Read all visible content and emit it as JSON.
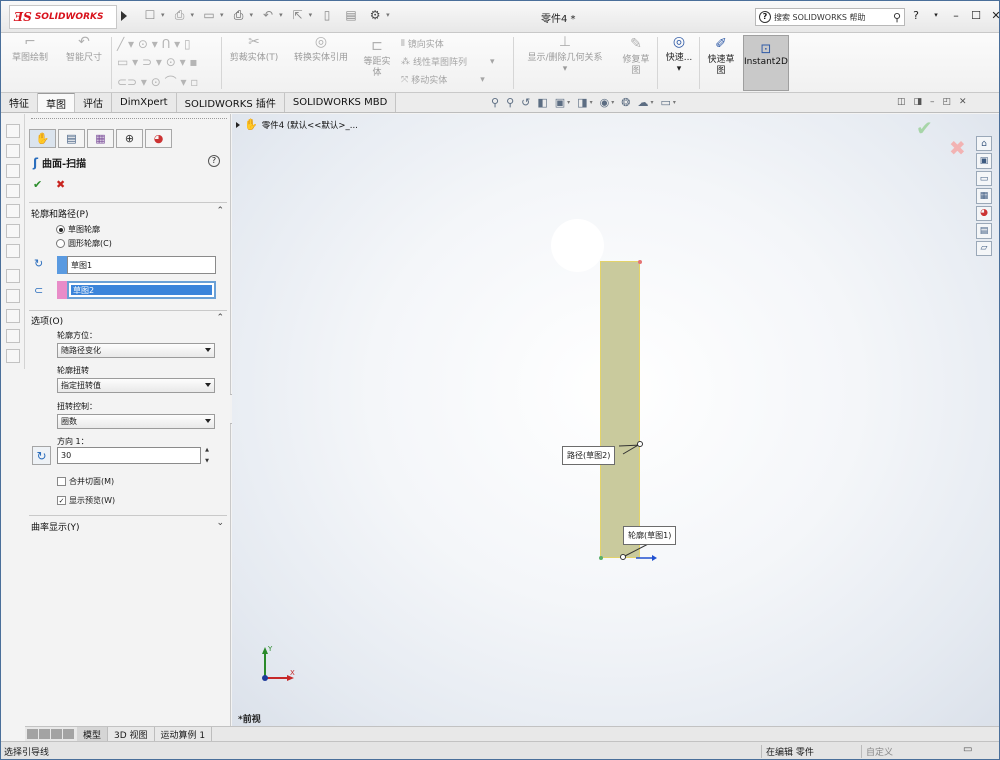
{
  "app": {
    "logo_ds": "ƎS",
    "logo_text": "SOLIDWORKS",
    "doc_title": "零件4 *",
    "help_search_label": "搜索 SOLIDWORKS 帮助"
  },
  "command_manager": {
    "sketch": "草图绘制",
    "smart_dim": "智能尺寸",
    "trim": "剪裁实体(T)",
    "convert": "转换实体引用",
    "offset": "等距实\n体",
    "mirror": "镜向实体",
    "linear_pattern": "线性草图阵列",
    "move": "移动实体",
    "relations": "显示/删除几何关系",
    "repair": "修复草\n图",
    "quick_snap": "快速...",
    "rapid_sketch": "快速草\n图",
    "instant2d": "Instant2D"
  },
  "tabs": [
    "特征",
    "草图",
    "评估",
    "DimXpert",
    "SOLIDWORKS 插件",
    "SOLIDWORKS MBD"
  ],
  "active_tab": 1,
  "property_manager": {
    "title": "曲面-扫描",
    "help": "?",
    "ok": "✔",
    "cancel": "✖",
    "group_profile_path": {
      "title": "轮廓和路径(P)",
      "toggle": "⌃",
      "radio_sketch_profile": "草图轮廓",
      "radio_circular_profile": "圆形轮廓(C)",
      "profile_value": "草图1",
      "path_value": "草图2",
      "profile_color": "#5a9ae0",
      "path_color": "#e88cc8"
    },
    "group_options": {
      "title": "选项(O)",
      "toggle": "⌃",
      "orientation_label": "轮廓方位：",
      "orientation_value": "随路径变化",
      "twist_label": "轮廓扭转",
      "twist_value": "指定扭转值",
      "twist_control_label": "扭转控制：",
      "twist_control_value": "圈数",
      "direction_label": "方向 1：",
      "direction_value": "30",
      "merge_tangent": "合并切面(M)",
      "merge_checked": false,
      "show_preview": "显示预览(W)",
      "preview_checked": true
    },
    "group_curvature": {
      "title": "曲率显示(Y)",
      "toggle": "⌄"
    }
  },
  "graphics": {
    "tree_label": "零件4  (默认<<默认>_...",
    "path_callout": "路径(草图2)",
    "profile_callout": "轮廓(草图1)",
    "view_name": "*前视",
    "triad_y": "Y",
    "triad_x": "X"
  },
  "model_tabs": [
    "模型",
    "3D 视图",
    "运动算例 1"
  ],
  "status": {
    "message": "选择引导线",
    "editing": "在编辑 零件",
    "custom": "自定义"
  },
  "colors": {
    "sweep_fill": "#c9ca9d",
    "sweep_edge": "#e3d36a",
    "ok_green": "#2b8d2b",
    "cancel_red": "#c8231e",
    "brand_red": "#d8111b"
  }
}
